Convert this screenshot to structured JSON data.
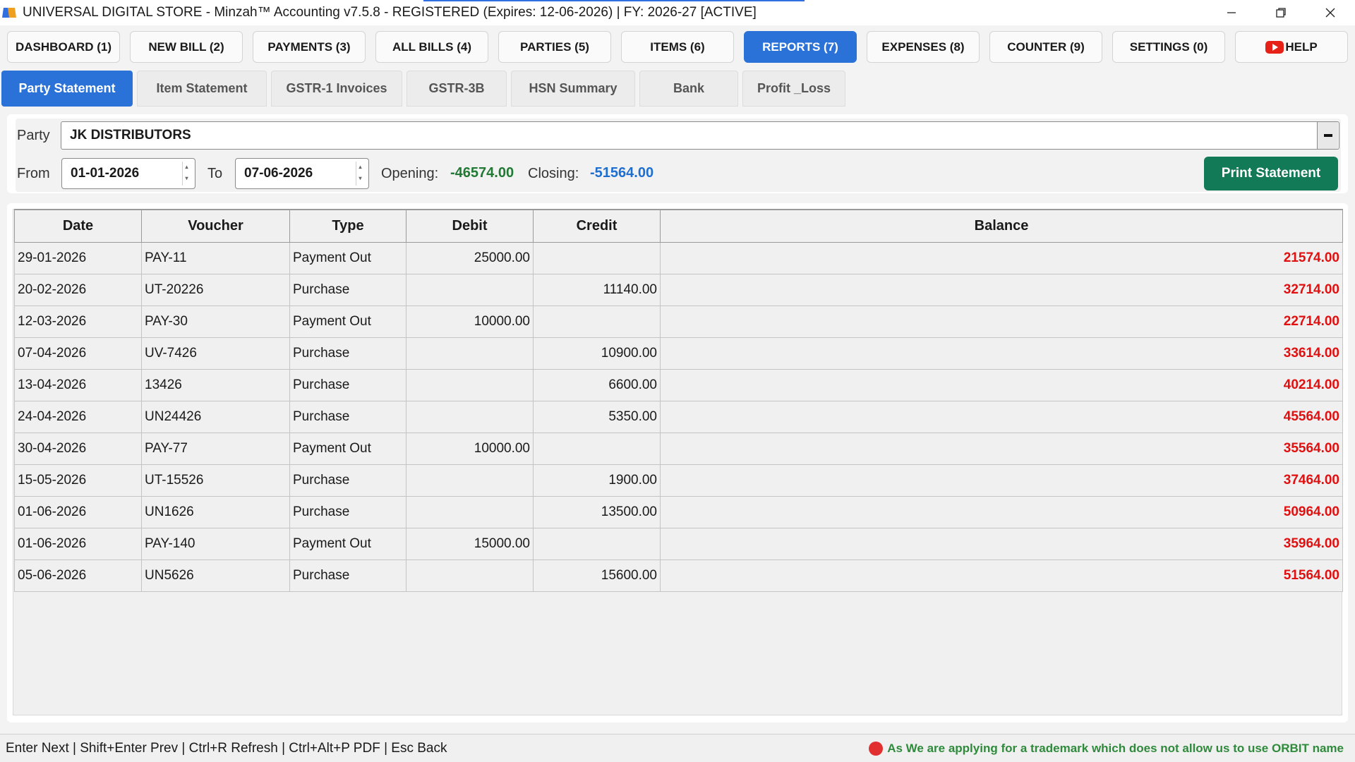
{
  "window": {
    "title": "UNIVERSAL DIGITAL STORE - Minzah™ Accounting v7.5.8 - REGISTERED (Expires: 12-06-2026) | FY: 2026-27 [ACTIVE]"
  },
  "main_tabs": [
    {
      "label": "DASHBOARD (1)"
    },
    {
      "label": "NEW BILL (2)"
    },
    {
      "label": "PAYMENTS (3)"
    },
    {
      "label": "ALL BILLS (4)"
    },
    {
      "label": "PARTIES (5)"
    },
    {
      "label": "ITEMS (6)"
    },
    {
      "label": "REPORTS (7)",
      "active": true
    },
    {
      "label": "EXPENSES (8)"
    },
    {
      "label": "COUNTER (9)"
    },
    {
      "label": "SETTINGS (0)"
    },
    {
      "label": "HELP",
      "icon": "youtube-icon"
    }
  ],
  "sub_tabs": [
    {
      "label": "Party Statement",
      "active": true
    },
    {
      "label": "Item Statement"
    },
    {
      "label": "GSTR-1 Invoices"
    },
    {
      "label": "GSTR-3B"
    },
    {
      "label": "HSN Summary"
    },
    {
      "label": "Bank"
    },
    {
      "label": "Profit _Loss"
    }
  ],
  "filters": {
    "party_label": "Party",
    "party_value": "JK DISTRIBUTORS",
    "from_label": "From",
    "from_value": "01-01-2026",
    "to_label": "To",
    "to_value": "07-06-2026",
    "opening_label": "Opening:",
    "opening_value": "-46574.00",
    "closing_label": "Closing:",
    "closing_value": "-51564.00",
    "print_button": "Print Statement"
  },
  "table": {
    "columns": [
      "Date",
      "Voucher",
      "Type",
      "Debit",
      "Credit",
      "Balance"
    ],
    "rows": [
      {
        "date": "29-01-2026",
        "voucher": "PAY-11",
        "type": "Payment Out",
        "debit": "25000.00",
        "credit": "",
        "balance": "21574.00"
      },
      {
        "date": "20-02-2026",
        "voucher": "UT-20226",
        "type": "Purchase",
        "debit": "",
        "credit": "11140.00",
        "balance": "32714.00"
      },
      {
        "date": "12-03-2026",
        "voucher": "PAY-30",
        "type": "Payment Out",
        "debit": "10000.00",
        "credit": "",
        "balance": "22714.00"
      },
      {
        "date": "07-04-2026",
        "voucher": "UV-7426",
        "type": "Purchase",
        "debit": "",
        "credit": "10900.00",
        "balance": "33614.00"
      },
      {
        "date": "13-04-2026",
        "voucher": "13426",
        "type": "Purchase",
        "debit": "",
        "credit": "6600.00",
        "balance": "40214.00"
      },
      {
        "date": "24-04-2026",
        "voucher": "UN24426",
        "type": "Purchase",
        "debit": "",
        "credit": "5350.00",
        "balance": "45564.00"
      },
      {
        "date": "30-04-2026",
        "voucher": "PAY-77",
        "type": "Payment Out",
        "debit": "10000.00",
        "credit": "",
        "balance": "35564.00"
      },
      {
        "date": "15-05-2026",
        "voucher": "UT-15526",
        "type": "Purchase",
        "debit": "",
        "credit": "1900.00",
        "balance": "37464.00"
      },
      {
        "date": "01-06-2026",
        "voucher": "UN1626",
        "type": "Purchase",
        "debit": "",
        "credit": "13500.00",
        "balance": "50964.00"
      },
      {
        "date": "01-06-2026",
        "voucher": "PAY-140",
        "type": "Payment Out",
        "debit": "15000.00",
        "credit": "",
        "balance": "35964.00"
      },
      {
        "date": "05-06-2026",
        "voucher": "UN5626",
        "type": "Purchase",
        "debit": "",
        "credit": "15600.00",
        "balance": "51564.00"
      }
    ]
  },
  "status": {
    "shortcuts": "Enter Next | Shift+Enter Prev | Ctrl+R Refresh | Ctrl+Alt+P PDF | Esc Back",
    "notice": "As We are applying for a trademark which does not allow us to use ORBIT name"
  },
  "colors": {
    "accent": "#2a72d8",
    "print_button": "#137a57",
    "opening_amount": "#217a34",
    "closing_amount": "#1e6fd0",
    "balance": "#e01010"
  }
}
